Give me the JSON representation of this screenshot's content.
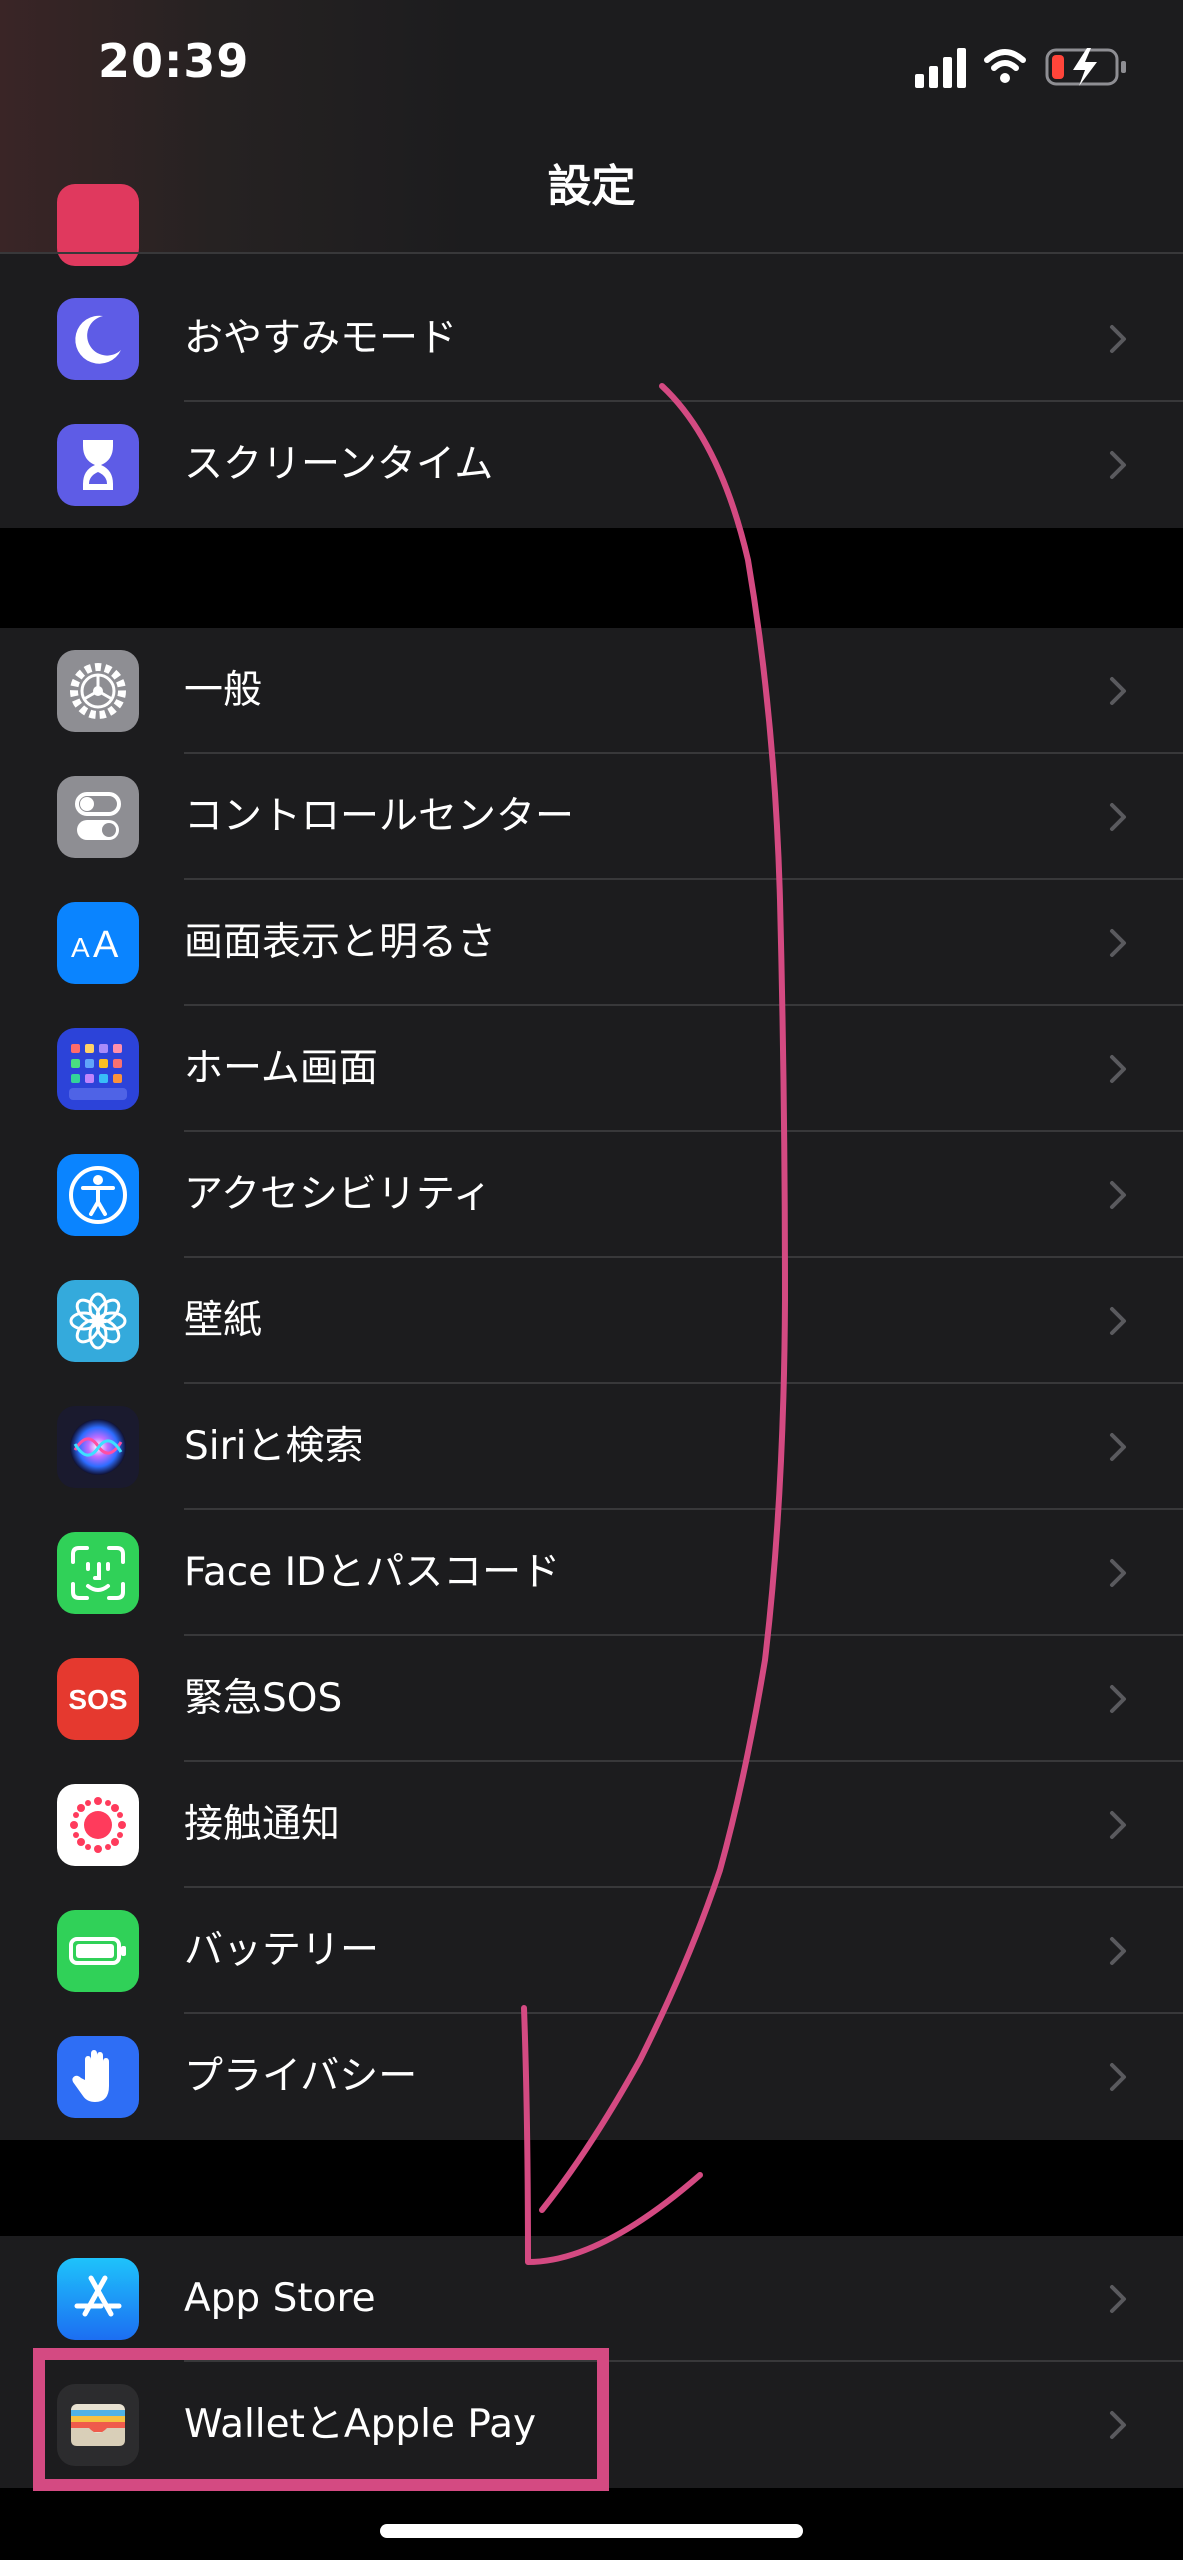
{
  "status_bar": {
    "time": "20:39",
    "signal_icon": "cellular-signal-icon",
    "wifi_icon": "wifi-icon",
    "battery_icon": "battery-charging-icon"
  },
  "nav": {
    "title": "設定"
  },
  "groups": [
    {
      "items": [
        {
          "label": "おやすみモード",
          "icon": "moon-icon",
          "color": "#5e5ce6"
        },
        {
          "label": "スクリーンタイム",
          "icon": "hourglass-icon",
          "color": "#5e5ce6"
        }
      ]
    },
    {
      "items": [
        {
          "label": "一般",
          "icon": "gear-icon",
          "color": "#8e8e93"
        },
        {
          "label": "コントロールセンター",
          "icon": "toggles-icon",
          "color": "#8e8e93"
        },
        {
          "label": "画面表示と明るさ",
          "icon": "text-size-icon",
          "color": "#0a84ff"
        },
        {
          "label": "ホーム画面",
          "icon": "home-grid-icon",
          "color": "#2c43d9"
        },
        {
          "label": "アクセシビリティ",
          "icon": "accessibility-icon",
          "color": "#0a84ff"
        },
        {
          "label": "壁紙",
          "icon": "flower-icon",
          "color": "#34aadc"
        },
        {
          "label": "Siriと検索",
          "icon": "siri-icon",
          "color": "#1a1a2e"
        },
        {
          "label": "Face IDとパスコード",
          "icon": "face-id-icon",
          "color": "#30d158"
        },
        {
          "label": "緊急SOS",
          "icon": "sos-icon",
          "color": "#e5392f"
        },
        {
          "label": "接触通知",
          "icon": "exposure-notification-icon",
          "color": "#ffffff"
        },
        {
          "label": "バッテリー",
          "icon": "battery-icon",
          "color": "#30d158"
        },
        {
          "label": "プライバシー",
          "icon": "hand-icon",
          "color": "#2e6ef5"
        }
      ]
    },
    {
      "items": [
        {
          "label": "App Store",
          "icon": "app-store-icon",
          "color": "#1c8ef9"
        },
        {
          "label": "WalletとApple Pay",
          "icon": "wallet-icon",
          "color": "#2c2c2e"
        }
      ]
    }
  ],
  "annotation": {
    "color": "#d44a82",
    "arrow_icon": "hand-drawn-arrow-icon",
    "highlight": "wallet-row-highlight"
  }
}
